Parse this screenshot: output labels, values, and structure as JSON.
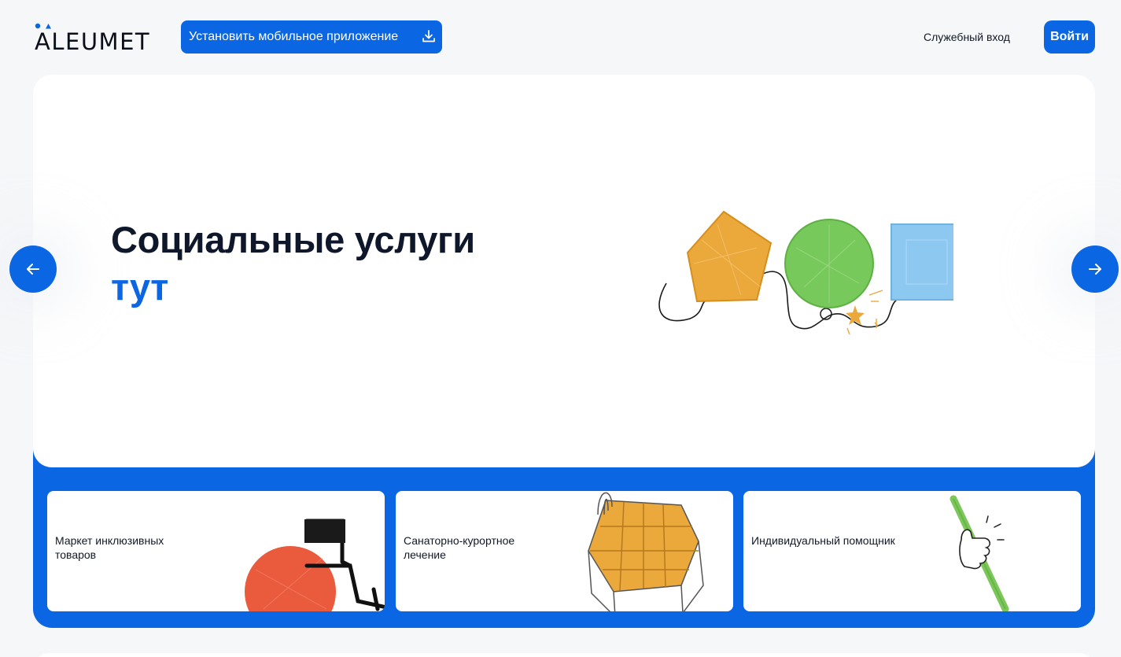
{
  "header": {
    "logo_text": "ALEUMET",
    "install_label": "Установить мобильное приложение",
    "service_login_label": "Служебный вход",
    "login_label": "Войти"
  },
  "hero": {
    "title_line1": "Социальные услуги",
    "title_line2": "тут"
  },
  "cards": [
    {
      "label": "Маркет инклюзивных товаров",
      "icon": "wheelchair-illustration"
    },
    {
      "label": "Санаторно-курортное лечение",
      "icon": "pool-illustration"
    },
    {
      "label": "Индивидуальный помощник",
      "icon": "thumbs-up-cane-illustration"
    }
  ],
  "colors": {
    "brand_blue": "#0b66e4",
    "background": "#f6f7f9",
    "text_dark": "#0f172a"
  }
}
